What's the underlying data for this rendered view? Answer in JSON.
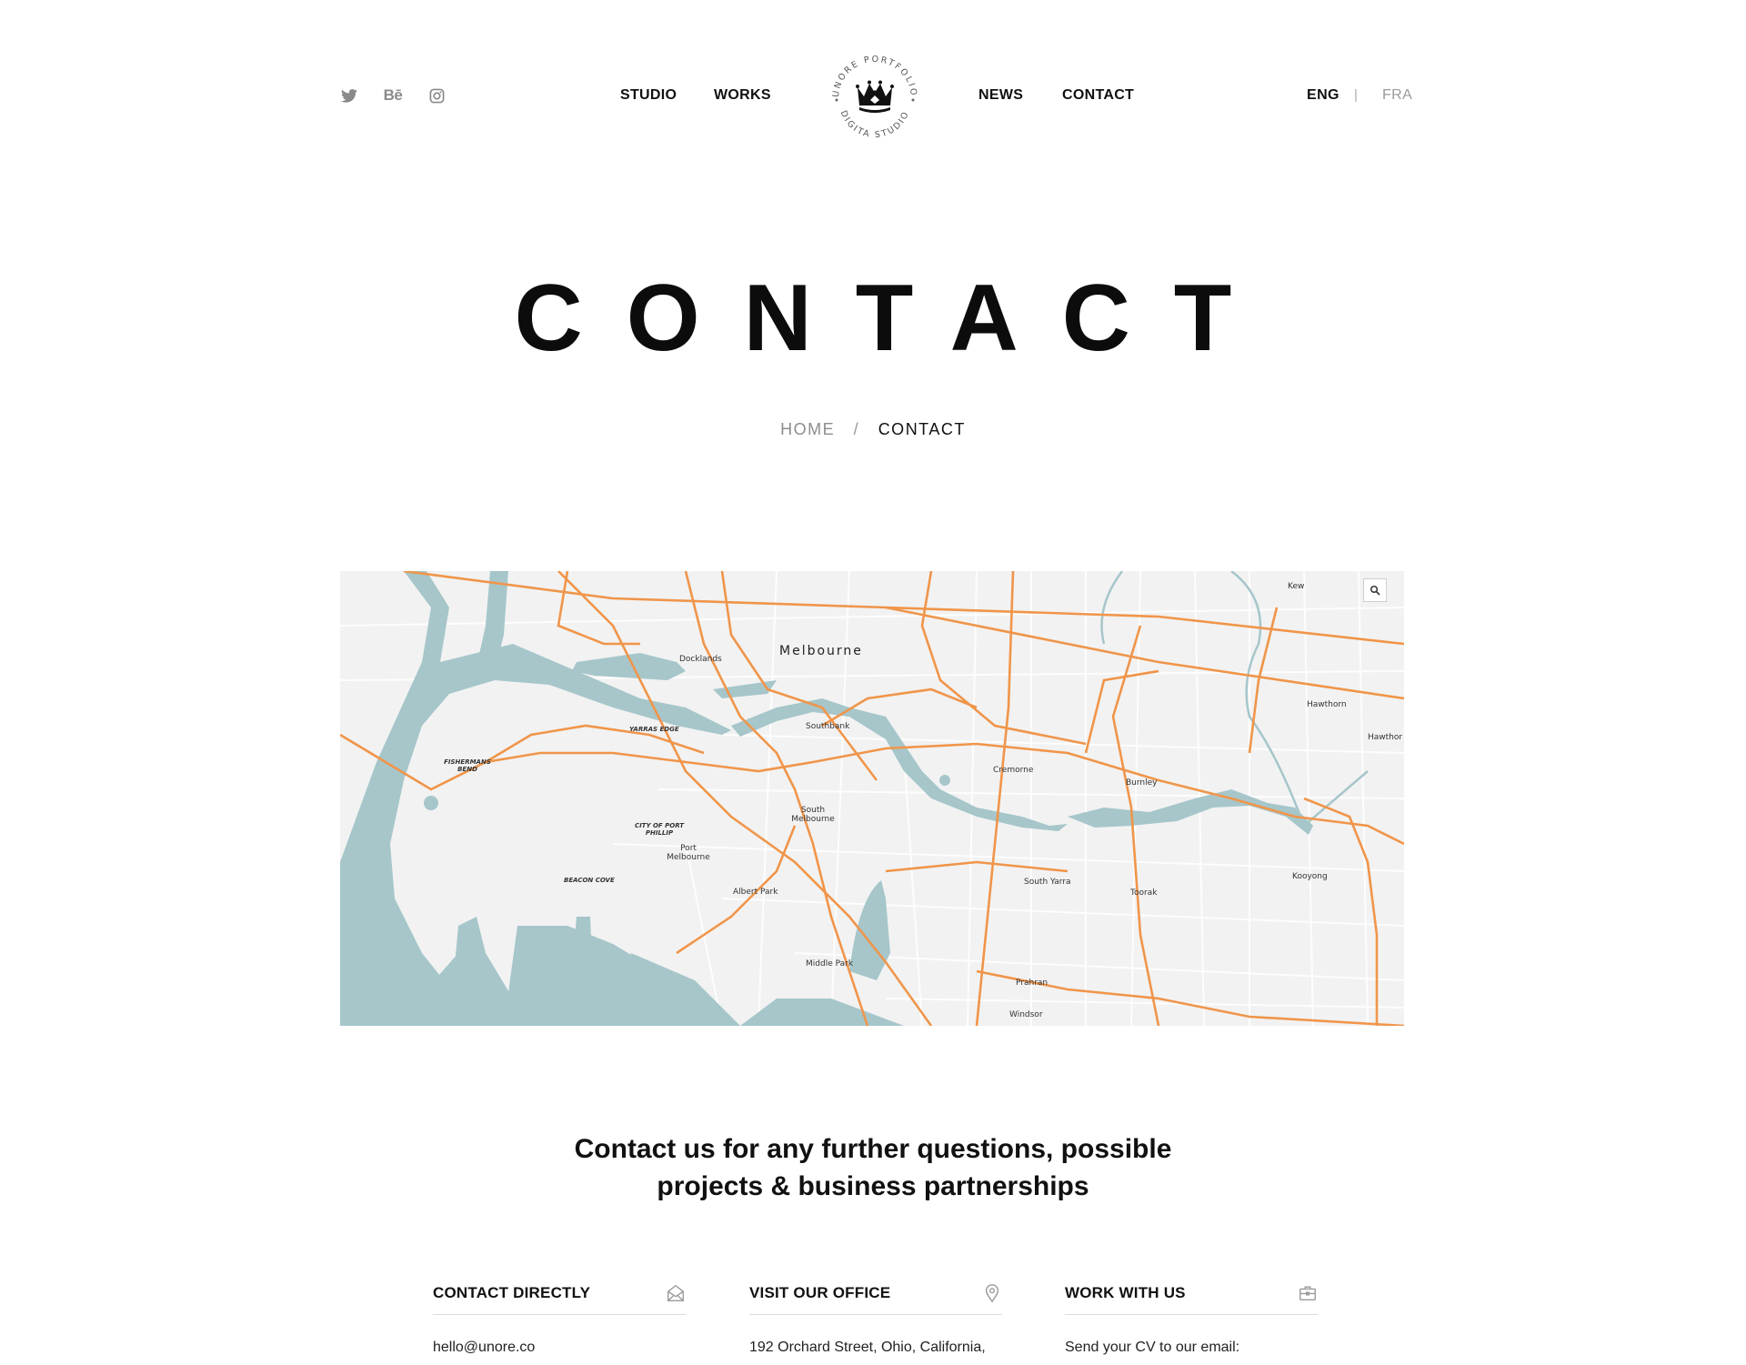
{
  "social": {
    "twitter_icon": "twitter-icon",
    "behance_label": "Bē",
    "instagram_icon": "instagram-icon"
  },
  "nav": {
    "studio": "STUDIO",
    "works": "WORKS",
    "news": "NEWS",
    "contact": "CONTACT"
  },
  "logo": {
    "top_text": "UNORE PORTFOLIO",
    "bottom_text": "DIGITA STUDIO"
  },
  "lang": {
    "active": "ENG",
    "separator": "|",
    "other": "FRA"
  },
  "page_title": "CONTACT",
  "breadcrumb": {
    "home": "HOME",
    "separator": "/",
    "current": "CONTACT"
  },
  "map": {
    "labels": {
      "melbourne": "Melbourne",
      "docklands": "Docklands",
      "southbank": "Southbank",
      "south_melbourne": "South Melbourne",
      "port_melbourne": "Port Melbourne",
      "albert_park": "Albert Park",
      "middle_park": "Middle Park",
      "cremorne": "Cremorne",
      "burnley": "Burnley",
      "south_yarra": "South Yarra",
      "toorak": "Toorak",
      "prahran": "Prahran",
      "windsor": "Windsor",
      "kooyong": "Kooyong",
      "hawthorn": "Hawthorn",
      "hawthorn_east": "Hawthor",
      "kew": "Kew",
      "yarras_edge": "YARRAS EDGE",
      "fishermans_bend": "FISHERMANS BEND",
      "city_of_port_phillip": "CITY OF PORT PHILLIP",
      "beacon_cove": "BEACON COVE"
    },
    "zoom_icon": "magnifier-icon"
  },
  "tagline": {
    "line1": "Contact us for any further questions, possible",
    "line2": "projects & business partnerships"
  },
  "columns": [
    {
      "title": "CONTACT DIRECTLY",
      "icon": "envelope-open-icon",
      "text": "hello@unore.co"
    },
    {
      "title": "VISIT OUR OFFICE",
      "icon": "location-pin-icon",
      "text": "192 Orchard Street, Ohio, California,"
    },
    {
      "title": "WORK WITH US",
      "icon": "briefcase-icon",
      "text": "Send your CV to our email:"
    }
  ],
  "colors": {
    "text": "#111111",
    "muted": "#8d8d8d",
    "map_road": "#f0954a",
    "map_water": "#a6c6ca",
    "map_land": "#f2f2f2"
  }
}
